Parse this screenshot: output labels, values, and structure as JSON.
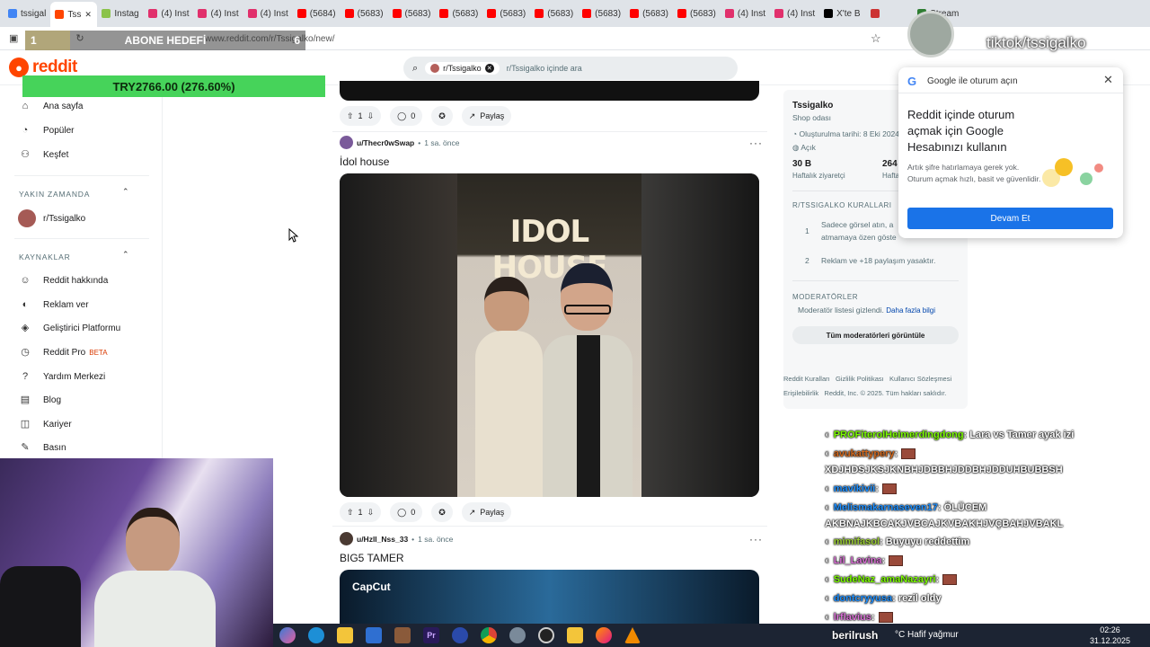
{
  "browser": {
    "tabs": [
      {
        "label": "tssigal",
        "color": "#4285f4"
      },
      {
        "label": "Tss",
        "color": "#ff4500",
        "active": true
      },
      {
        "label": "Instag",
        "color": "#8bc34a"
      },
      {
        "label": "(4) Inst",
        "color": "#e1306c"
      },
      {
        "label": "(4) Inst",
        "color": "#e1306c"
      },
      {
        "label": "(4) Inst",
        "color": "#e1306c"
      },
      {
        "label": "(5684)",
        "color": "#ff0000"
      },
      {
        "label": "(5683)",
        "color": "#ff0000"
      },
      {
        "label": "(5683)",
        "color": "#ff0000"
      },
      {
        "label": "(5683)",
        "color": "#ff0000"
      },
      {
        "label": "(5683)",
        "color": "#ff0000"
      },
      {
        "label": "(5683)",
        "color": "#ff0000"
      },
      {
        "label": "(5683)",
        "color": "#ff0000"
      },
      {
        "label": "(5683)",
        "color": "#ff0000"
      },
      {
        "label": "(5683)",
        "color": "#ff0000"
      },
      {
        "label": "(4) Inst",
        "color": "#e1306c"
      },
      {
        "label": "(4) Inst",
        "color": "#e1306c"
      },
      {
        "label": "X'te B",
        "color": "#000000"
      },
      {
        "label": "",
        "color": "#cc3333"
      },
      {
        "label": "Stream",
        "color": "#2e7d32"
      }
    ],
    "url": "www.reddit.com/r/Tssigalko/new/"
  },
  "reddit": {
    "logo_text": "reddit",
    "search_chip": "r/Tssigalko",
    "search_placeholder": "r/Tssigalko içinde ara"
  },
  "sidebar": {
    "main": [
      {
        "label": "Ana sayfa",
        "icon": "home-icon"
      },
      {
        "label": "Popüler",
        "icon": "popular-icon"
      },
      {
        "label": "Keşfet",
        "icon": "explore-icon"
      }
    ],
    "recent_header": "YAKIN ZAMANDA",
    "recent": [
      {
        "label": "r/Tssigalko"
      }
    ],
    "resources_header": "KAYNAKLAR",
    "resources": [
      {
        "label": "Reddit hakkında"
      },
      {
        "label": "Reklam ver"
      },
      {
        "label": "Geliştirici Platformu"
      },
      {
        "label": "Reddit Pro",
        "badge": "BETA"
      },
      {
        "label": "Yardım Merkezi"
      },
      {
        "label": "Blog"
      },
      {
        "label": "Kariyer"
      },
      {
        "label": "Basın"
      }
    ]
  },
  "posts": [
    {
      "votes": "1",
      "comments": "0",
      "share": "Paylaş"
    },
    {
      "user": "u/Thecr0wSwap",
      "time": "1 sa. önce",
      "title": "İdol house",
      "video_text": "IDOL HOUSE",
      "votes": "1",
      "comments": "0",
      "share": "Paylaş"
    },
    {
      "user": "u/Hzll_Nss_33",
      "time": "1 sa. önce",
      "title": "BIG5 TAMER",
      "video_text": "CapCut"
    }
  ],
  "right": {
    "name": "Tssigalko",
    "subtitle": "Shop odası",
    "created": "Oluşturulma tarihi: 8 Eki 2024",
    "status": "Açık",
    "visits": "30 B",
    "visits_label": "Haftalık ziyaretçi",
    "contrib": "264",
    "contrib_label": "Hafta",
    "rules_header": "R/TSSIGALKO KURALLARI",
    "rule1": "Sadece görsel atın, a",
    "rule1b": "atmamaya özen göste",
    "rule2": "Reklam ve +18 paylaşım yasaktır.",
    "mods_header": "MODERATÖRLER",
    "mods_hidden": "Moderatör listesi gizlendi.",
    "mods_more": "Daha fazla bilgi",
    "mods_button": "Tüm moderatörleri görüntüle",
    "footer1": "Reddit Kuralları   Gizlilik Politikası   Kullanıcı Sözleşmesi",
    "footer2": "Erişilebilirlik   Reddit, Inc. © 2025. Tüm hakları saklıdır."
  },
  "google": {
    "header": "Google ile oturum açın",
    "title": "Reddit içinde oturum açmak için Google Hesabınızı kullanın",
    "body": "Artık şifre hatırlamaya gerek yok. Oturum açmak hızlı, basit ve güvenlidir.",
    "button": "Devam Et"
  },
  "overlay": {
    "abone_left": "1",
    "abone_label": "ABONE HEDEFİ",
    "abone_right": "6",
    "abone_fraction": 0.16,
    "stock": "TRY2766.00 (276.60%)",
    "tiktok": "tiktok/tssigalko",
    "streamer": "berilrush"
  },
  "chat": [
    {
      "user": "PROFiterolHeimerdingdong",
      "user_color": "#7cfc00",
      "msg": ": Lara vs Tamer ayak izi"
    },
    {
      "user": "avukattypery",
      "user_color": "#d2691e",
      "msg": ":"
    },
    {
      "user": "",
      "user_color": "#ffffff",
      "msg": "XDJHDSJKSJKNBHJDBBHJDDBHJDDUHBUBBSH"
    },
    {
      "user": "mavikivii",
      "user_color": "#1e90ff",
      "msg": ":"
    },
    {
      "user": "Melismakarnaseven17",
      "user_color": "#1e90ff",
      "msg": ": ÖLÜCEM"
    },
    {
      "user": "",
      "user_color": "#ffffff",
      "msg": "AKBNAJKBCAKJVBCAJKVBAKHJVÇBAHJVBAKL"
    },
    {
      "user": "mimifasol",
      "user_color": "#9acd32",
      "msg": ": Buyuyu reddettim"
    },
    {
      "user": "Lil_Lavina",
      "user_color": "#da70d6",
      "msg": ":"
    },
    {
      "user": "SudeNaz_amaNazayri",
      "user_color": "#7cfc00",
      "msg": ":"
    },
    {
      "user": "dontcryyusa",
      "user_color": "#1e90ff",
      "msg": ": rezil oldy"
    },
    {
      "user": "lrflavius",
      "user_color": "#da70d6",
      "msg": ":"
    }
  ],
  "taskbar": {
    "weather": "°C  Hafif yağmur",
    "time": "02:26",
    "date": "31.12.2025"
  }
}
